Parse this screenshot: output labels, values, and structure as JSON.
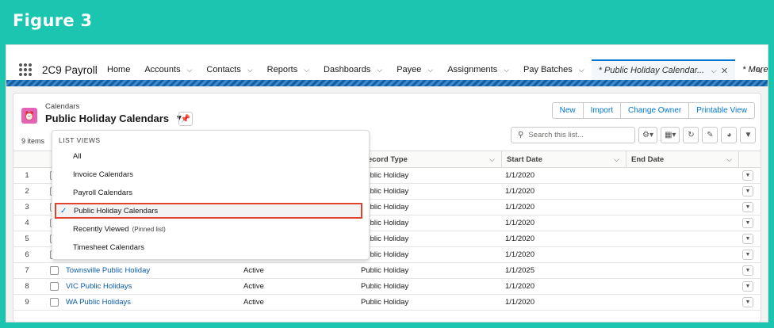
{
  "figure_title": "Figure 3",
  "app": {
    "name": "2C9 Payroll",
    "nav": [
      {
        "label": "Home",
        "chevron": false
      },
      {
        "label": "Accounts",
        "chevron": true
      },
      {
        "label": "Contacts",
        "chevron": true
      },
      {
        "label": "Reports",
        "chevron": true
      },
      {
        "label": "Dashboards",
        "chevron": true
      },
      {
        "label": "Payee",
        "chevron": true
      },
      {
        "label": "Assignments",
        "chevron": true
      },
      {
        "label": "Pay Batches",
        "chevron": true
      }
    ],
    "active_tab": "* Public Holiday Calendar...",
    "more": "* More"
  },
  "list": {
    "object_label": "Calendars",
    "title": "Public Holiday Calendars",
    "count": "9 items",
    "buttons": [
      "New",
      "Import",
      "Change Owner",
      "Printable View"
    ],
    "search_placeholder": "Search this list...",
    "columns": [
      "Record Type",
      "Start Date",
      "End Date"
    ],
    "rows": [
      {
        "num": "1",
        "name": "",
        "status": "",
        "record_type": "Public Holiday",
        "start_date": "1/1/2020"
      },
      {
        "num": "2",
        "name": "",
        "status": "",
        "record_type": "Public Holiday",
        "start_date": "1/1/2020"
      },
      {
        "num": "3",
        "name": "",
        "status": "",
        "record_type": "Public Holiday",
        "start_date": "1/1/2020"
      },
      {
        "num": "4",
        "name": "",
        "status": "",
        "record_type": "Public Holiday",
        "start_date": "1/1/2020"
      },
      {
        "num": "5",
        "name": "",
        "status": "",
        "record_type": "Public Holiday",
        "start_date": "1/1/2020"
      },
      {
        "num": "6",
        "name": "",
        "status": "",
        "record_type": "Public Holiday",
        "start_date": "1/1/2020"
      },
      {
        "num": "7",
        "name": "Townsville Public Holiday",
        "status": "Active",
        "record_type": "Public Holiday",
        "start_date": "1/1/2025"
      },
      {
        "num": "8",
        "name": "VIC Public Holidays",
        "status": "Active",
        "record_type": "Public Holiday",
        "start_date": "1/1/2020"
      },
      {
        "num": "9",
        "name": "WA Public Holidays",
        "status": "Active",
        "record_type": "Public Holiday",
        "start_date": "1/1/2020"
      }
    ]
  },
  "list_views": {
    "header": "LIST VIEWS",
    "items": [
      {
        "label": "All",
        "note": "",
        "selected": false
      },
      {
        "label": "Invoice Calendars",
        "note": "",
        "selected": false
      },
      {
        "label": "Payroll Calendars",
        "note": "",
        "selected": false
      },
      {
        "label": "Public Holiday Calendars",
        "note": "",
        "selected": true
      },
      {
        "label": "Recently Viewed",
        "note": "(Pinned list)",
        "selected": false
      },
      {
        "label": "Timesheet Calendars",
        "note": "",
        "selected": false
      }
    ]
  },
  "colors": {
    "teal": "#1cc5b0",
    "link": "#0b5cab",
    "brand": "#0176d3",
    "highlight": "#e0442b",
    "object_icon": "#e563b7"
  }
}
